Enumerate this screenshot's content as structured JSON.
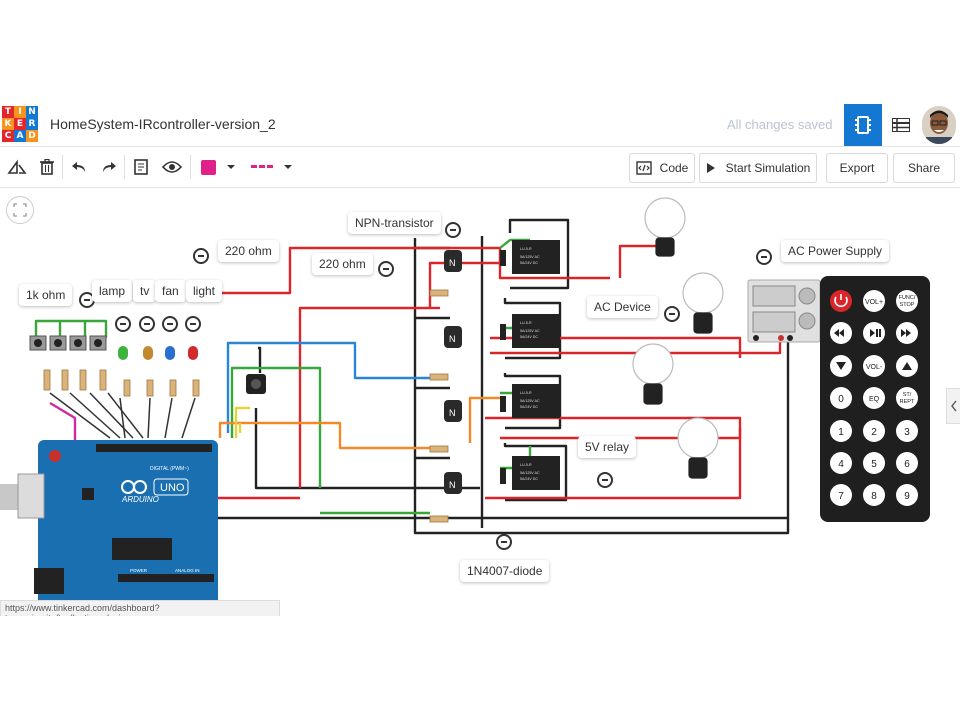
{
  "logo": {
    "letters": [
      "T",
      "I",
      "N",
      "K",
      "E",
      "R",
      "C",
      "A",
      "D"
    ],
    "colors": [
      "#e2262c",
      "#f7941e",
      "#1477d1",
      "#f7941e",
      "#e2262c",
      "#1477d1",
      "#e2262c",
      "#1477d1",
      "#f7941e"
    ]
  },
  "header": {
    "title": "HomeSystem-IRcontroller-version_2",
    "saved_status": "All changes saved",
    "accent": "#1477d1"
  },
  "toolbar": {
    "fill_color": "#e0218a",
    "line_color": "#e0218a",
    "code_label": "Code",
    "simulate_label": "Start Simulation",
    "export_label": "Export",
    "share_label": "Share"
  },
  "annotations": {
    "r1k": "1k ohm",
    "lamp": "lamp",
    "tv": "tv",
    "fan": "fan",
    "light": "light",
    "r220a": "220 ohm",
    "r220b": "220 ohm",
    "npn": "NPN-transistor",
    "ac_device": "AC Device",
    "ac_supply": "AC Power Supply",
    "relay": "5V relay",
    "diode": "1N4007-diode"
  },
  "arduino": {
    "brand": "ARDUINO",
    "model": "UNO",
    "digital": "DIGITAL (PWM~)",
    "analog": "ANALOG IN",
    "power": "POWER"
  },
  "relay_text": [
    "LU-5-R",
    "5A/125V AC",
    "5A/24V DC"
  ],
  "remote": {
    "buttons": [
      "VOL+",
      "FUNC/STOP",
      "VOL-",
      "EQ",
      "ST/REPT",
      "0",
      "1",
      "2",
      "3",
      "4",
      "5",
      "6",
      "7",
      "8",
      "9"
    ]
  },
  "status_url": "https://www.tinkercad.com/dashboard?type=circuits&collection=designs"
}
